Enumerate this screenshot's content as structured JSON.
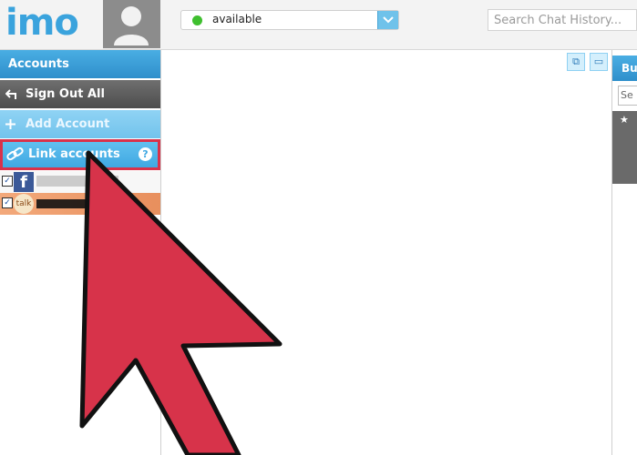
{
  "header": {
    "logo_text": "imo",
    "status_value": "available",
    "search_placeholder": "Search Chat History..."
  },
  "sidebar": {
    "title": "Accounts",
    "sign_out_label": "Sign Out All",
    "add_account_label": "Add Account",
    "link_accounts_label": "Link accounts",
    "help_glyph": "?",
    "accounts": [
      {
        "service": "facebook",
        "logo": "f",
        "checked": true
      },
      {
        "service": "talk",
        "logo": "talk",
        "checked": true
      }
    ]
  },
  "right_panel": {
    "header_label": "Bu",
    "search_fragment": "Se"
  },
  "colors": {
    "accent": "#3aa3dd",
    "highlight_border": "#d9324b",
    "arrow": "#d7334a"
  }
}
